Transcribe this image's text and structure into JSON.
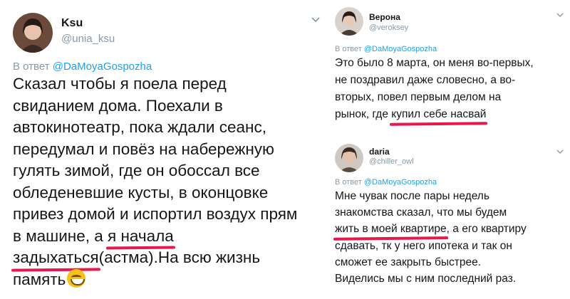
{
  "left_tweet": {
    "name": "Ksu",
    "handle": "@unia_ksu",
    "reply_prefix": "В ответ ",
    "reply_mention": "@DaMoyaGospozha",
    "lines": [
      "Сказал чтобы я поела перед",
      "свиданием дома. Поехали в",
      "автокинотеатр, пока ждали сеанс,",
      "передумал и повёз на набережную",
      "гулять зимой, где он обоссал все",
      "обледеневшие кусты, в оконцовке",
      "привез домой и испортил воздух прям"
    ],
    "line8_pre": "в машине, а ",
    "line8_hl": "я начала",
    "line9_hl": "задыхаться",
    "line9_post": "(астма).На всю жизнь",
    "line10": "память",
    "emoji_icon": "grinning-face-emoji"
  },
  "right_top_tweet": {
    "name": "Верона",
    "handle": "@veroksey",
    "reply_prefix": "В ответ ",
    "reply_mention": "@DaMoyaGospozha",
    "lines": [
      "Это было 8 марта, он меня во-первых,",
      "не поздравил даже словесно, а во-",
      "вторых, повел первым делом на"
    ],
    "line4_pre": "рынок, где ",
    "line4_hl": "купил себе насвай"
  },
  "right_bottom_tweet": {
    "name": "daria",
    "handle": "@chiller_owl",
    "reply_prefix": "В ответ ",
    "reply_mention": "@DaMoyaGospozha",
    "lines": [
      "Мне чувак после пары недель",
      "знакомства сказал, что мы будем"
    ],
    "line3_hl": "жить в моей квартире",
    "line3_post": ", а его квартиру",
    "lines_after": [
      "сдавать, тк у него ипотека и так он",
      "сможет ее закрыть быстрее.",
      "Виделись мы с ним последний раз."
    ]
  },
  "colors": {
    "highlight": "#e8174c",
    "mention": "#1da1f2",
    "muted": "#8899a6"
  }
}
